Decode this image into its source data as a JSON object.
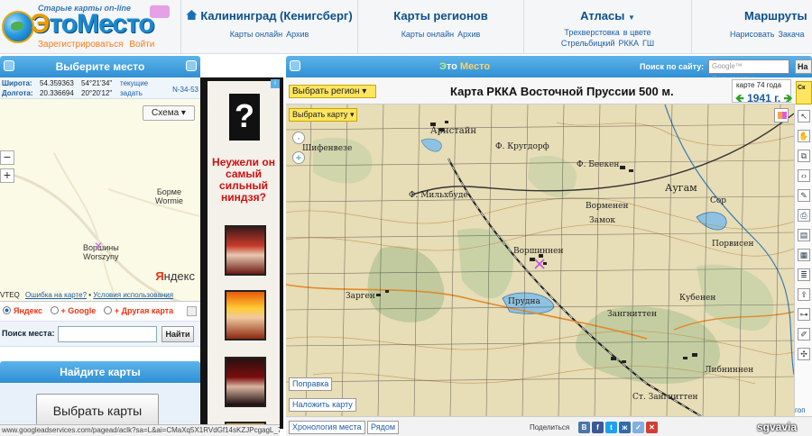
{
  "header": {
    "logo": {
      "tagline": "Старые карты on-line",
      "word_a": "Э",
      "word_b": "тоМесто",
      "register": "Зарегистрироваться",
      "login": "Войти"
    },
    "nav": [
      {
        "title": "Калининград (Кенигсберг)",
        "links": [
          "Карты онлайн",
          "Архив"
        ]
      },
      {
        "title": "Карты регионов",
        "links": [
          "Карты онлайн",
          "Архив"
        ]
      },
      {
        "title": "Атласы",
        "links": [
          "Трехверстовка",
          "в цвете",
          "Стрельбицкий",
          "РККА",
          "ГШ"
        ]
      },
      {
        "title": "Маршруты",
        "links": [
          "Нарисовать",
          "Закача"
        ]
      }
    ]
  },
  "left_panel": {
    "title": "Выберите место",
    "gps_label": "gps",
    "lat_label": "Широта:",
    "lat_value": "54.359363",
    "lat_dms": "54°21'34\"",
    "lon_label": "Долгота:",
    "lon_value": "20.336694",
    "lon_dms": "20°20'12\"",
    "link_current": "текущие",
    "link_set": "задать",
    "sheet": "N-34-53",
    "schema_button": "Схема",
    "mini_labels": [
      {
        "top": "Борме",
        "bottom": "Wormie"
      },
      {
        "top": "Воршины",
        "bottom": "Worszyny"
      }
    ],
    "yandex_logo_a": "Я",
    "yandex_logo_b": "ндекс",
    "footer_vteq": "VTEQ",
    "footer_error": "Ошибка на карте?",
    "footer_terms": "Условия использования",
    "providers": [
      "Яндекс",
      "+ Google",
      "+ Другая карта"
    ],
    "search_label": "Поиск места:",
    "search_value": "",
    "search_button": "Найти",
    "find_maps_title": "Найдите карты",
    "choose_maps_button": "Выбрать карты"
  },
  "ad": {
    "question_mark": "?",
    "text": "Неужели он самый сильный ниндзя?",
    "info": "i"
  },
  "map_panel": {
    "brand_a": "Э",
    "brand_b": "то ",
    "brand_c": "Место",
    "site_search_label": "Поиск по сайту:",
    "google_placeholder": "Google™ Пользователь",
    "search_button": "На",
    "region_button": "Выбрать регион",
    "map_button": "Выбрать карту",
    "title": "Карта РККА Восточной Пруссии 500 м.",
    "year_caption": "карте 74 года",
    "year_value": "1941 г.",
    "side_tab": "Ск",
    "labels": [
      "Арнстайн",
      "Шифенвезе",
      "Ф. Мильхбуде",
      "Ф. Кругдорф",
      "Ф. Беекен",
      "Аугам",
      "Сор",
      "Ворменен",
      "Воршиннен",
      "Прудна",
      "Зарген",
      "Зангниттен",
      "Либниннен",
      "Ст. Зангниттен",
      "Замок",
      "Порвисен",
      "Кубенен"
    ],
    "correction_button": "Поправка",
    "overlay_button": "Наложить карту",
    "chronology_button": "Хронология места",
    "nearby_button": "Рядом",
    "share_label": "Поделиться",
    "social": [
      "В",
      "f",
      "t",
      "ж",
      "✓",
      "✕"
    ],
    "tool_go": "гоп",
    "watermark": "sgvavia"
  },
  "status_bar": {
    "url": "www.googleadservices.com/pagead/aclk?sa=L&ai=CMaXq5X1RVdGf14sKZJPcgagL_7..."
  }
}
